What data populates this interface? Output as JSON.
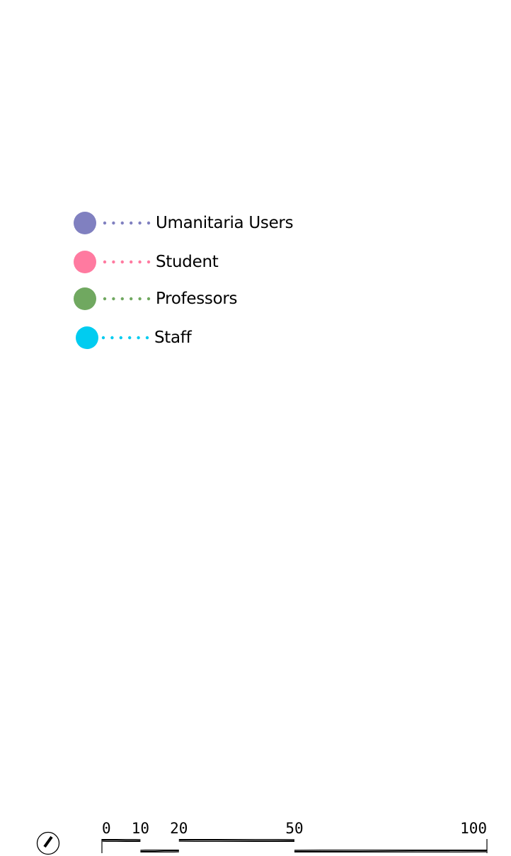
{
  "legend": {
    "items": [
      {
        "label": "Umanitaria Users",
        "color": "#8080c0",
        "icon": "circle-marker"
      },
      {
        "label": "Student",
        "color": "#ff7aa0",
        "icon": "circle-marker"
      },
      {
        "label": "Professors",
        "color": "#70a860",
        "icon": "circle-marker"
      },
      {
        "label": "Staff",
        "color": "#00ccf0",
        "icon": "circle-marker"
      }
    ]
  },
  "north_arrow": {
    "icon": "north-arrow-icon"
  },
  "scale_bar": {
    "ticks": [
      "0",
      "10",
      "20",
      "50",
      "100"
    ],
    "tick_values": [
      0,
      10,
      20,
      50,
      100
    ]
  }
}
